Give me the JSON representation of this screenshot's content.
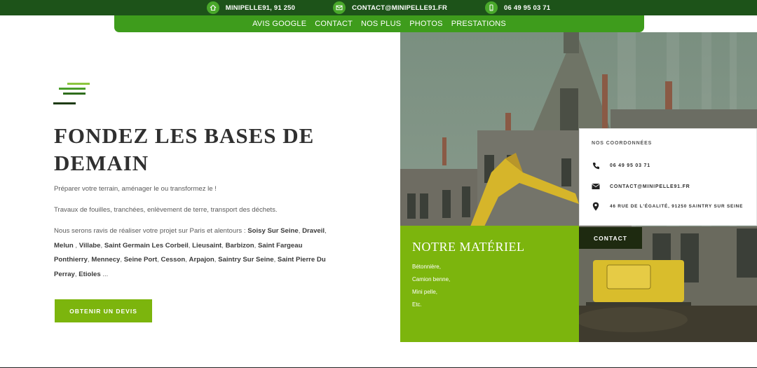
{
  "topbar": {
    "items": [
      {
        "icon": "home-icon",
        "text": "MINIPELLE91, 91 250"
      },
      {
        "icon": "mail-icon",
        "text": "CONTACT@MINIPELLE91.FR"
      },
      {
        "icon": "phone-icon",
        "text": "06 49 95 03 71"
      }
    ]
  },
  "nav": {
    "items": [
      "AVIS GOOGLE",
      "CONTACT",
      "NOS PLUS",
      "PHOTOS",
      "PRESTATIONS"
    ]
  },
  "hero": {
    "title_line1": "FONDEZ LES BASES DE",
    "title_line2": "DEMAIN",
    "p1": "Préparer votre terrain, aménager le ou transformez le !",
    "p2": "Travaux de fouilles, tranchées, enlèvement de terre, transport des déchets.",
    "p3_intro": "Nous serons ravis de réaliser votre projet sur Paris et alentours : ",
    "places": [
      "Soisy Sur Seine",
      "Draveil",
      "Melun",
      "Villabe",
      "Saint Germain Les Corbeil",
      "Lieusaint",
      "Barbizon",
      "Saint Fargeau Ponthierry",
      "Mennecy",
      "Seine Port",
      "Cesson",
      "Arpajon",
      "Saintry Sur Seine",
      "Saint Pierre Du Perray",
      "Etioles"
    ],
    "p3_end": " ...",
    "button": "OBTENIR UN DEVIS"
  },
  "coordonnees": {
    "title": "NOS COORDONNÉES",
    "phone": "06 49 95 03 71",
    "email": "CONTACT@MINIPELLE91.FR",
    "address": "46 RUE DE L'ÉGALITÉ, 91250 SAINTRY SUR SEINE"
  },
  "materiel": {
    "title": "NOTRE MATÉRIEL",
    "items": [
      "Bétonnière,",
      "Camion benne,",
      "Mini pelle,",
      "Etc."
    ]
  },
  "contact_button": "CONTACT",
  "colors": {
    "dark_green": "#1d5319",
    "nav_green": "#3e9c1c",
    "lime": "#7cb50d"
  }
}
